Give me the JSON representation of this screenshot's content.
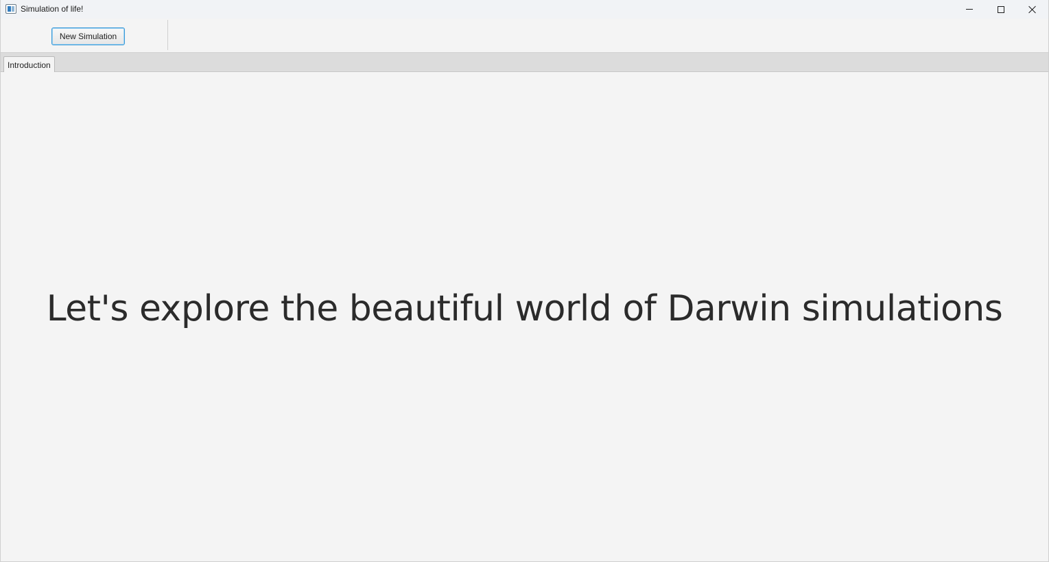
{
  "window": {
    "title": "Simulation of life!"
  },
  "toolbar": {
    "new_simulation_label": "New Simulation"
  },
  "tabs": [
    {
      "label": "Introduction",
      "selected": true
    }
  ],
  "main": {
    "headline": "Let's explore the beautiful world of Darwin simulations"
  },
  "icons": {
    "app": "app-window-icon",
    "minimize": "minimize-icon",
    "maximize": "maximize-icon",
    "close": "close-icon"
  }
}
